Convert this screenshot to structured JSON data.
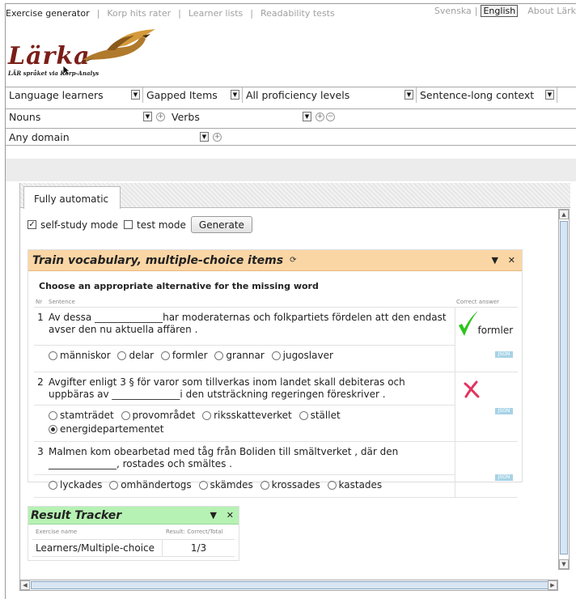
{
  "nav": {
    "items": [
      "Exercise generator",
      "Korp hits rater",
      "Learner lists",
      "Readability tests"
    ],
    "languages": [
      "Svenska",
      "English"
    ],
    "about": "About Lärk"
  },
  "logo": {
    "word": "Lärka",
    "subtitle": "LÄR språket via Korp-Analys"
  },
  "selectors": {
    "row1": [
      "Language learners",
      "Gapped Items",
      "All proficiency levels",
      "Sentence-long context"
    ],
    "row2": [
      "Nouns",
      "Verbs"
    ],
    "row3": [
      "Any domain"
    ]
  },
  "tab": {
    "label": "Fully automatic"
  },
  "controls": {
    "self_study_label": "self-study mode",
    "self_study_checked": true,
    "test_mode_label": "test mode",
    "test_mode_checked": false,
    "generate_label": "Generate"
  },
  "exercise": {
    "title": "Train vocabulary, multiple-choice items",
    "header_color": "#fbd6a5",
    "instruction": "Choose an appropriate alternative for the missing word",
    "col_nr": "Nr",
    "col_sentence": "Sentence",
    "col_answer": "Correct answer",
    "json_badge": "JSON",
    "items": [
      {
        "nr": "1",
        "sentence": "Av dessa ______________har moderaternas och folkpartiets fördelen att den endast avser den nu aktuella affären .",
        "options": [
          "människor",
          "delar",
          "formler",
          "grannar",
          "jugoslaver"
        ],
        "selected": -1,
        "status": "correct",
        "correct_answer": "formler"
      },
      {
        "nr": "2",
        "sentence": "Avgifter enligt 3 § för varor som tillverkas inom landet skall debiteras och uppbäras av ______________i den utsträckning regeringen föreskriver .",
        "options": [
          "stamträdet",
          "provområdet",
          "riksskatteverket",
          "stället",
          "energidepartementet"
        ],
        "selected": 4,
        "status": "wrong",
        "correct_answer": ""
      },
      {
        "nr": "3",
        "sentence": "Malmen kom obearbetad med tåg från Boliden till smältverket , där den ______________, rostades och smältes .",
        "options": [
          "lyckades",
          "omhändertogs",
          "skämdes",
          "krossades",
          "kastades"
        ],
        "selected": -1,
        "status": "none",
        "correct_answer": ""
      }
    ],
    "status_colors": {
      "correct": "#2ec41c",
      "wrong": "#e2345f"
    }
  },
  "tracker": {
    "title": "Result Tracker",
    "header_color": "#b6f2b3",
    "col_name": "Exercise name",
    "col_result": "Result: Correct/Total",
    "row_name": "Learners/Multiple-choice",
    "row_result": "1/3"
  },
  "icons": {
    "dropdown": "triangle-down",
    "add": "plus-circle",
    "remove": "minus-circle",
    "refresh": "refresh-icon",
    "collapse": "triangle-down",
    "close": "x"
  }
}
